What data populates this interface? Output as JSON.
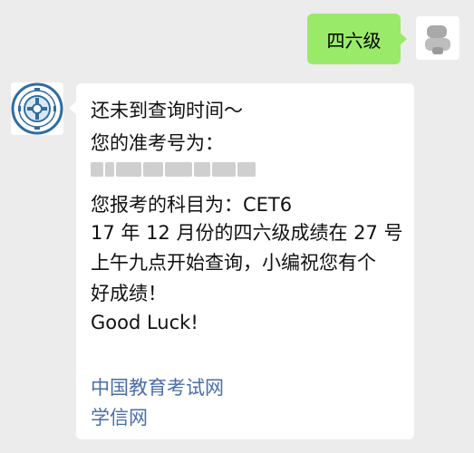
{
  "user_message": {
    "text": "四六级"
  },
  "bot_message": {
    "line1": "还未到查询时间～",
    "line2": "您的准考号为：",
    "line3": "您报考的科目为：CET6",
    "line4": "17 年 12 月份的四六级成绩在 27 号",
    "line5": "上午九点开始查询，小编祝您有个",
    "line6": "好成绩！",
    "line7": "Good Luck!",
    "links": [
      "中国教育考试网",
      "学信网"
    ]
  },
  "colors": {
    "background": "#ececec",
    "sent_bubble": "#9aea6a",
    "received_bubble": "#ffffff",
    "link": "#4a6ea8"
  },
  "icons": {
    "user_avatar": "blurred-avatar-icon",
    "bot_avatar": "university-seal-icon"
  }
}
